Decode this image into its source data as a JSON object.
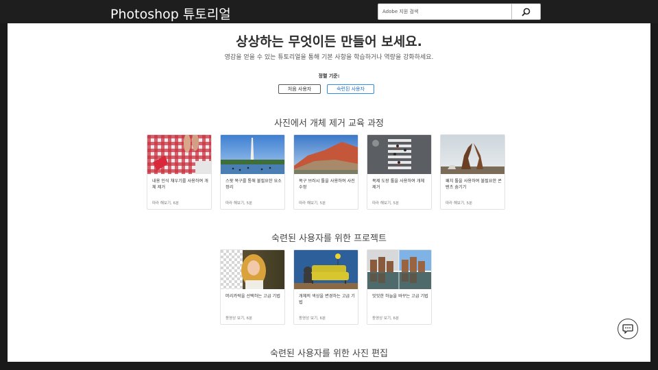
{
  "header": {
    "brand": "Photoshop 튜토리얼",
    "search_placeholder": "Adobe 지원 검색"
  },
  "hero": {
    "title": "상상하는 무엇이든 만들어 보세요.",
    "subtitle": "영감을 얻을 수 있는 튜토리얼을 통해 기본 사항을 학습하거나 역량을 강화하세요.",
    "sort_label": "정렬 기준:",
    "sort_options": [
      "처음 사용자",
      "숙련된 사용자"
    ],
    "sort_selected": "숙련된 사용자"
  },
  "sections": [
    {
      "title": "사진에서 개체 제거 교육 과정",
      "cards": [
        {
          "title": "내용 인식 채우기를 사용하여 개체 제거",
          "meta": "따라 해보기, 6분",
          "image": "picnic-blanket"
        },
        {
          "title": "스팟 복구를 통해 불필요한 요소 정리",
          "meta": "따라 해보기, 5분",
          "image": "washington-monument"
        },
        {
          "title": "복구 브러시 툴을 사용하여 사진 수정",
          "meta": "따라 해보기, 5분",
          "image": "red-mountain"
        },
        {
          "title": "복제 도장 툴을 사용하여 개체 제거",
          "meta": "따라 해보기, 5분",
          "image": "crosswalk"
        },
        {
          "title": "패치 툴을 사용하여 불필요한 콘텐츠 숨기기",
          "meta": "따라 해보기, 5분",
          "image": "horses"
        }
      ]
    },
    {
      "title": "숙련된 사용자를 위한 프로젝트",
      "cards": [
        {
          "title": "머리카락을 선택하는 고급 기법",
          "meta": "동영상 보기, 6분",
          "image": "woman-hair"
        },
        {
          "title": "개체의 색상을 변경하는 고급 기법",
          "meta": "동영상 보기, 6분",
          "image": "yellow-sofa"
        },
        {
          "title": "밋밋한 하늘을 바꾸는 고급 기법",
          "meta": "동영상 보기, 6분",
          "image": "canal-houses"
        }
      ]
    },
    {
      "title": "숙련된 사용자를 위한 사진 편집",
      "cards": []
    }
  ],
  "icons": {
    "search": "search-icon",
    "chat": "chat-icon"
  },
  "colors": {
    "topbar": "#1e1e1e",
    "accent": "#2d8ae6"
  }
}
